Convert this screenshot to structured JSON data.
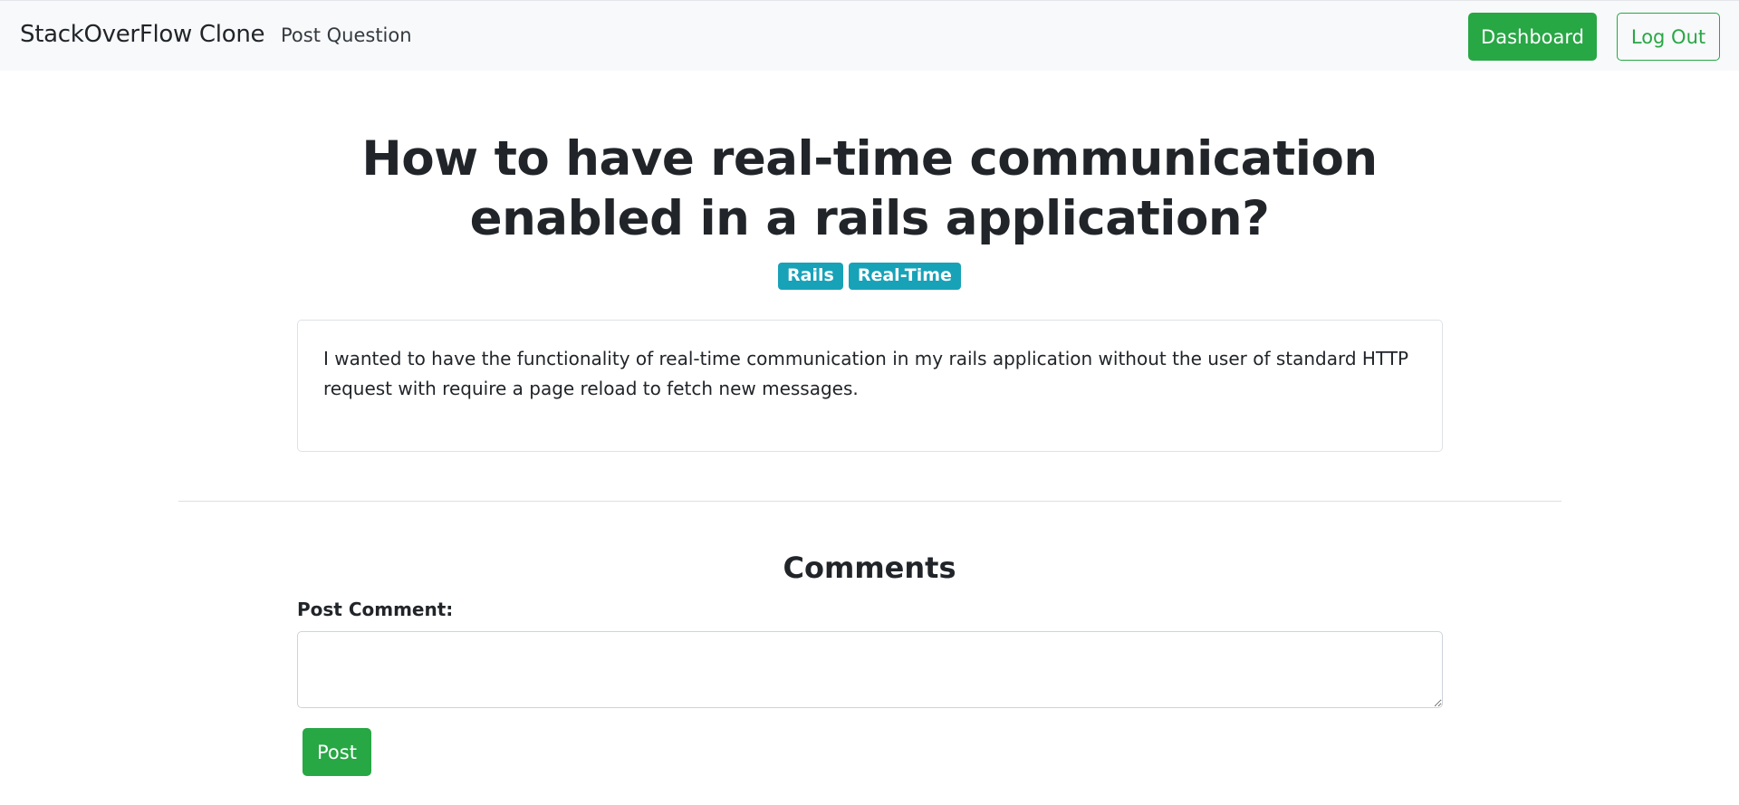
{
  "navbar": {
    "brand": "StackOverFlow Clone",
    "links": [
      {
        "label": "Post Question"
      }
    ],
    "dashboard_label": "Dashboard",
    "logout_label": "Log Out"
  },
  "question": {
    "title": "How to have real-time communication enabled in a rails application?",
    "tags": [
      "Rails",
      "Real-Time"
    ],
    "body": "I wanted to have the functionality of real-time communication in my rails application without the user of standard HTTP request with require a page reload to fetch new messages."
  },
  "comments": {
    "heading": "Comments",
    "form_label": "Post Comment:",
    "textarea_value": "",
    "submit_label": "Post"
  },
  "colors": {
    "success": "#28a745",
    "info": "#17a2b8",
    "navbar_bg": "#f8f9fa",
    "text": "#212529"
  }
}
